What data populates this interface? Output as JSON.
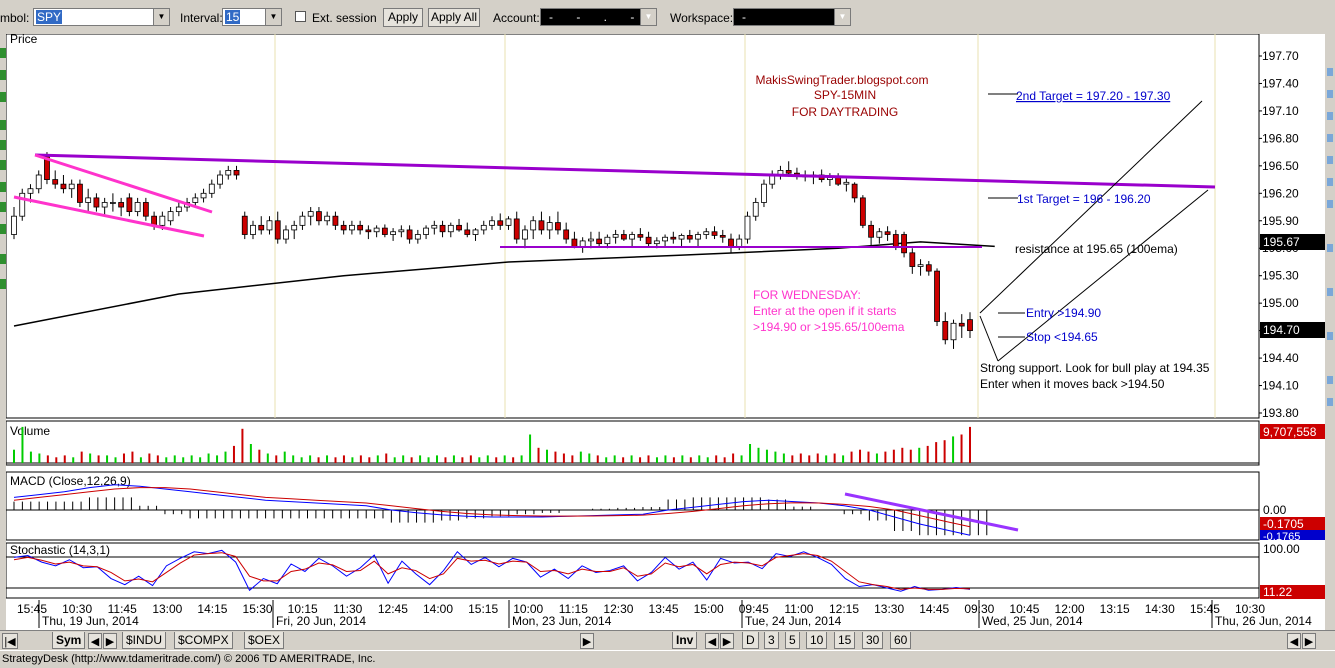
{
  "toolbar": {
    "symbol_label": "mbol:",
    "symbol_value": "SPY",
    "interval_label": "Interval:",
    "interval_value": "15",
    "ext_session_label": "Ext. session",
    "apply_label": "Apply",
    "apply_all_label": "Apply All",
    "account_label": "Account:",
    "account_value": "- - . -",
    "workspace_label": "Workspace:",
    "workspace_value": "-"
  },
  "chart_data": {
    "type": "candlestick",
    "symbol": "SPY",
    "interval": "15",
    "price_panel": {
      "label": "Price",
      "ylim": [
        193.8,
        197.7
      ],
      "yticks": [
        "197.70",
        "197.40",
        "197.10",
        "196.80",
        "196.50",
        "196.20",
        "195.90",
        "195.60",
        "195.30",
        "195.00",
        "194.70",
        "194.40",
        "194.10",
        "193.80"
      ],
      "price_tags": [
        {
          "value": "195.67",
          "price": 195.67,
          "bg": "#000000",
          "fg": "#ffffff"
        },
        {
          "value": "194.70",
          "price": 194.7,
          "bg": "#000000",
          "fg": "#ffffff"
        }
      ],
      "candles": [
        [
          195.75,
          196.05,
          195.7,
          195.95
        ],
        [
          195.95,
          196.25,
          195.9,
          196.2
        ],
        [
          196.2,
          196.3,
          196.1,
          196.25
        ],
        [
          196.25,
          196.45,
          196.2,
          196.4
        ],
        [
          196.6,
          196.65,
          196.3,
          196.35
        ],
        [
          196.35,
          196.45,
          196.25,
          196.3
        ],
        [
          196.3,
          196.4,
          196.2,
          196.25
        ],
        [
          196.25,
          196.35,
          196.15,
          196.3
        ],
        [
          196.3,
          196.35,
          196.05,
          196.1
        ],
        [
          196.1,
          196.25,
          196.0,
          196.15
        ],
        [
          196.15,
          196.2,
          196.0,
          196.05
        ],
        [
          196.05,
          196.15,
          195.95,
          196.1
        ],
        [
          196.1,
          196.2,
          196.0,
          196.1
        ],
        [
          196.1,
          196.15,
          195.95,
          196.05
        ],
        [
          196.15,
          196.2,
          195.95,
          196.0
        ],
        [
          196.0,
          196.15,
          195.95,
          196.1
        ],
        [
          196.1,
          196.15,
          195.9,
          195.95
        ],
        [
          195.95,
          196.0,
          195.8,
          195.85
        ],
        [
          195.85,
          196.0,
          195.8,
          195.95
        ],
        [
          195.9,
          196.05,
          195.85,
          196.0
        ],
        [
          196.0,
          196.1,
          195.95,
          196.05
        ],
        [
          196.05,
          196.15,
          196.0,
          196.1
        ],
        [
          196.1,
          196.2,
          196.05,
          196.15
        ],
        [
          196.15,
          196.25,
          196.1,
          196.2
        ],
        [
          196.2,
          196.35,
          196.15,
          196.3
        ],
        [
          196.3,
          196.45,
          196.25,
          196.4
        ],
        [
          196.4,
          196.5,
          196.35,
          196.45
        ],
        [
          196.45,
          196.5,
          196.35,
          196.4
        ],
        [
          195.95,
          196.0,
          195.7,
          195.75
        ],
        [
          195.75,
          195.9,
          195.7,
          195.85
        ],
        [
          195.85,
          195.95,
          195.75,
          195.8
        ],
        [
          195.8,
          195.95,
          195.75,
          195.9
        ],
        [
          195.9,
          196.0,
          195.65,
          195.7
        ],
        [
          195.7,
          195.85,
          195.65,
          195.8
        ],
        [
          195.8,
          195.9,
          195.7,
          195.85
        ],
        [
          195.85,
          196.0,
          195.8,
          195.95
        ],
        [
          195.95,
          196.05,
          195.85,
          196.0
        ],
        [
          196.0,
          196.05,
          195.85,
          195.9
        ],
        [
          195.9,
          196.0,
          195.85,
          195.95
        ],
        [
          195.95,
          196.0,
          195.8,
          195.85
        ],
        [
          195.85,
          195.9,
          195.75,
          195.8
        ],
        [
          195.8,
          195.9,
          195.75,
          195.85
        ],
        [
          195.85,
          195.9,
          195.75,
          195.8
        ],
        [
          195.8,
          195.85,
          195.7,
          195.78
        ],
        [
          195.78,
          195.85,
          195.72,
          195.82
        ],
        [
          195.82,
          195.86,
          195.72,
          195.75
        ],
        [
          195.75,
          195.82,
          195.68,
          195.78
        ],
        [
          195.78,
          195.85,
          195.72,
          195.8
        ],
        [
          195.8,
          195.85,
          195.65,
          195.7
        ],
        [
          195.7,
          195.8,
          195.65,
          195.75
        ],
        [
          195.75,
          195.85,
          195.7,
          195.82
        ],
        [
          195.82,
          195.9,
          195.75,
          195.85
        ],
        [
          195.85,
          195.9,
          195.72,
          195.78
        ],
        [
          195.78,
          195.88,
          195.72,
          195.85
        ],
        [
          195.85,
          195.92,
          195.78,
          195.8
        ],
        [
          195.8,
          195.88,
          195.72,
          195.75
        ],
        [
          195.75,
          195.82,
          195.68,
          195.8
        ],
        [
          195.8,
          195.9,
          195.75,
          195.85
        ],
        [
          195.85,
          195.95,
          195.8,
          195.9
        ],
        [
          195.9,
          195.98,
          195.8,
          195.85
        ],
        [
          195.85,
          195.95,
          195.8,
          195.92
        ],
        [
          195.92,
          196.0,
          195.65,
          195.7
        ],
        [
          195.7,
          195.85,
          195.6,
          195.8
        ],
        [
          195.8,
          195.95,
          195.7,
          195.9
        ],
        [
          195.9,
          196.0,
          195.75,
          195.8
        ],
        [
          195.8,
          195.95,
          195.7,
          195.88
        ],
        [
          195.88,
          196.0,
          195.75,
          195.8
        ],
        [
          195.8,
          195.88,
          195.65,
          195.7
        ],
        [
          195.7,
          195.78,
          195.6,
          195.62
        ],
        [
          195.62,
          195.72,
          195.55,
          195.68
        ],
        [
          195.68,
          195.78,
          195.6,
          195.7
        ],
        [
          195.7,
          195.78,
          195.62,
          195.65
        ],
        [
          195.65,
          195.75,
          195.6,
          195.72
        ],
        [
          195.72,
          195.8,
          195.65,
          195.75
        ],
        [
          195.75,
          195.8,
          195.68,
          195.7
        ],
        [
          195.7,
          195.78,
          195.62,
          195.75
        ],
        [
          195.75,
          195.82,
          195.68,
          195.72
        ],
        [
          195.72,
          195.78,
          195.62,
          195.65
        ],
        [
          195.65,
          195.72,
          195.6,
          195.68
        ],
        [
          195.68,
          195.75,
          195.62,
          195.72
        ],
        [
          195.72,
          195.78,
          195.65,
          195.7
        ],
        [
          195.7,
          195.76,
          195.62,
          195.74
        ],
        [
          195.74,
          195.8,
          195.66,
          195.7
        ],
        [
          195.7,
          195.78,
          195.62,
          195.75
        ],
        [
          195.75,
          195.82,
          195.7,
          195.78
        ],
        [
          195.78,
          195.84,
          195.7,
          195.74
        ],
        [
          195.74,
          195.8,
          195.66,
          195.72
        ],
        [
          195.7,
          195.76,
          195.55,
          195.62
        ],
        [
          195.62,
          195.75,
          195.58,
          195.7
        ],
        [
          195.7,
          196.0,
          195.65,
          195.95
        ],
        [
          195.95,
          196.15,
          195.9,
          196.1
        ],
        [
          196.1,
          196.35,
          196.05,
          196.3
        ],
        [
          196.3,
          196.45,
          196.25,
          196.4
        ],
        [
          196.4,
          196.5,
          196.35,
          196.45
        ],
        [
          196.45,
          196.55,
          196.38,
          196.42
        ],
        [
          196.42,
          196.48,
          196.35,
          196.4
        ],
        [
          196.4,
          196.45,
          196.33,
          196.38
        ],
        [
          196.38,
          196.44,
          196.3,
          196.4
        ],
        [
          196.4,
          196.46,
          196.32,
          196.35
        ],
        [
          196.35,
          196.42,
          196.28,
          196.38
        ],
        [
          196.38,
          196.42,
          196.28,
          196.3
        ],
        [
          196.3,
          196.36,
          196.22,
          196.32
        ],
        [
          196.3,
          196.32,
          196.1,
          196.15
        ],
        [
          196.15,
          196.18,
          195.82,
          195.85
        ],
        [
          195.85,
          195.9,
          195.62,
          195.72
        ],
        [
          195.72,
          195.82,
          195.65,
          195.78
        ],
        [
          195.78,
          195.84,
          195.68,
          195.75
        ],
        [
          195.75,
          195.8,
          195.58,
          195.62
        ],
        [
          195.75,
          195.78,
          195.5,
          195.55
        ],
        [
          195.55,
          195.6,
          195.32,
          195.4
        ],
        [
          195.4,
          195.48,
          195.3,
          195.42
        ],
        [
          195.42,
          195.46,
          195.3,
          195.35
        ],
        [
          195.35,
          195.38,
          194.75,
          194.8
        ],
        [
          194.8,
          194.9,
          194.55,
          194.6
        ],
        [
          194.6,
          194.82,
          194.5,
          194.78
        ],
        [
          194.78,
          194.88,
          194.62,
          194.75
        ],
        [
          194.82,
          194.9,
          194.62,
          194.7
        ]
      ],
      "ema100": [
        [
          0,
          194.75
        ],
        [
          20,
          195.1
        ],
        [
          40,
          195.3
        ],
        [
          60,
          195.45
        ],
        [
          80,
          195.52
        ],
        [
          100,
          195.6
        ],
        [
          110,
          195.67
        ],
        [
          119,
          195.62
        ]
      ],
      "annotations": {
        "header_line1": "MakisSwingTrader.blogspot.com",
        "header_line2": "SPY-15MIN",
        "header_line3": "FOR DAYTRADING",
        "target2": "2nd Target = 197.20 - 197.30",
        "target1": "1st Target = 196 - 196.20",
        "resistance": "resistance at 195.65 (100ema)",
        "entry": "Entry >194.90",
        "stop": "Stop <194.65",
        "support_line1": "Strong support. Look for bull play at 194.35",
        "support_line2": "Enter when it moves back >194.50",
        "wednesday_line1": "FOR WEDNESDAY:",
        "wednesday_line2": "Enter at the open if it starts",
        "wednesday_line3": ">194.90 or >195.65/100ema"
      }
    },
    "volume_panel": {
      "label": "Volume",
      "value_tag": "9,707,558",
      "values": [
        0.35,
        0.95,
        0.3,
        0.25,
        0.2,
        0.15,
        0.2,
        0.15,
        0.3,
        0.25,
        0.2,
        0.2,
        0.15,
        0.25,
        0.3,
        0.15,
        0.25,
        0.2,
        0.15,
        0.2,
        0.15,
        0.2,
        0.15,
        0.25,
        0.2,
        0.3,
        0.45,
        0.9,
        0.5,
        0.35,
        0.25,
        0.2,
        0.3,
        0.2,
        0.15,
        0.2,
        0.15,
        0.2,
        0.15,
        0.2,
        0.15,
        0.2,
        0.15,
        0.2,
        0.25,
        0.15,
        0.2,
        0.15,
        0.2,
        0.15,
        0.2,
        0.15,
        0.2,
        0.15,
        0.2,
        0.15,
        0.2,
        0.15,
        0.2,
        0.15,
        0.2,
        0.75,
        0.4,
        0.35,
        0.3,
        0.25,
        0.2,
        0.3,
        0.25,
        0.2,
        0.15,
        0.2,
        0.15,
        0.2,
        0.15,
        0.2,
        0.15,
        0.2,
        0.15,
        0.2,
        0.15,
        0.2,
        0.15,
        0.2,
        0.15,
        0.25,
        0.2,
        0.5,
        0.4,
        0.35,
        0.3,
        0.25,
        0.2,
        0.25,
        0.2,
        0.25,
        0.2,
        0.25,
        0.2,
        0.3,
        0.35,
        0.3,
        0.25,
        0.3,
        0.35,
        0.4,
        0.35,
        0.4,
        0.45,
        0.55,
        0.6,
        0.7,
        0.75,
        0.95
      ]
    },
    "macd_panel": {
      "label": "MACD (Close,12,26,9)",
      "ytick": "0.00",
      "value_tags": [
        {
          "value": "-0.1705",
          "bg": "#cc0000",
          "fg": "#ffffff"
        },
        {
          "value": "-0.1765",
          "bg": "#0000cc",
          "fg": "#ffffff"
        }
      ],
      "macd": [
        0.09,
        0.11,
        0.13,
        0.16,
        0.18,
        0.17,
        0.15,
        0.13,
        0.11,
        0.09,
        0.07,
        0.06,
        0.05,
        0.04,
        0.03,
        0.0,
        -0.02,
        -0.035,
        -0.045,
        -0.05,
        -0.05,
        -0.05,
        -0.045,
        -0.04,
        -0.035,
        -0.03,
        0.0,
        0.02,
        0.04,
        0.06,
        0.07,
        0.06,
        0.05,
        0.03,
        0.0,
        -0.05,
        -0.1,
        -0.14,
        -0.18
      ],
      "signal": [
        0.07,
        0.09,
        0.11,
        0.13,
        0.15,
        0.16,
        0.16,
        0.15,
        0.13,
        0.11,
        0.09,
        0.08,
        0.07,
        0.06,
        0.05,
        0.03,
        0.01,
        -0.01,
        -0.025,
        -0.035,
        -0.04,
        -0.043,
        -0.044,
        -0.043,
        -0.04,
        -0.037,
        -0.025,
        -0.01,
        0.01,
        0.03,
        0.045,
        0.052,
        0.05,
        0.04,
        0.025,
        0.0,
        -0.04,
        -0.08,
        -0.12
      ]
    },
    "stochastic_panel": {
      "label": "Stochastic (14,3,1)",
      "ytick": "100.00",
      "value_tag": "11.22",
      "k": [
        80,
        84,
        70,
        62,
        75,
        58,
        60,
        35,
        22,
        40,
        20,
        62,
        78,
        92,
        88,
        95,
        70,
        10,
        35,
        24,
        66,
        50,
        78,
        62,
        40,
        58,
        85,
        25,
        72,
        45,
        22,
        52,
        92,
        65,
        80,
        60,
        78,
        70,
        38,
        55,
        35,
        62,
        48,
        52,
        62,
        30,
        48,
        80,
        55,
        70,
        32,
        78,
        68,
        70,
        56,
        88,
        82,
        92,
        80,
        65,
        35,
        18,
        22,
        15,
        8,
        18,
        10,
        12,
        16,
        12
      ],
      "d": [
        75,
        80,
        74,
        66,
        70,
        62,
        60,
        48,
        30,
        34,
        28,
        48,
        68,
        85,
        88,
        90,
        82,
        40,
        30,
        30,
        50,
        55,
        68,
        64,
        50,
        52,
        72,
        45,
        58,
        52,
        35,
        45,
        78,
        72,
        74,
        66,
        72,
        70,
        50,
        52,
        45,
        55,
        50,
        50,
        58,
        40,
        45,
        68,
        60,
        65,
        45,
        65,
        70,
        68,
        62,
        80,
        84,
        88,
        84,
        72,
        50,
        28,
        22,
        18,
        12,
        15,
        12,
        12,
        14,
        13
      ]
    },
    "x_axis": {
      "time_labels": [
        "15:45",
        "10:30",
        "11:45",
        "13:00",
        "14:15",
        "15:30",
        "10:15",
        "11:30",
        "12:45",
        "14:00",
        "15:15",
        "10:00",
        "11:15",
        "12:30",
        "13:45",
        "15:00",
        "09:45",
        "11:00",
        "12:15",
        "13:30",
        "14:45",
        "09:30",
        "10:45",
        "12:00",
        "13:15",
        "14:30",
        "15:45",
        "10:30"
      ],
      "date_labels": [
        "Thu, 19 Jun, 2014",
        "Fri, 20 Jun, 2014",
        "Mon, 23 Jun, 2014",
        "Tue, 24 Jun, 2014",
        "Wed, 25 Jun, 2014",
        "Thu, 26 Jun, 2014"
      ]
    }
  },
  "bottom": {
    "sym_label": "Sym",
    "inv_label": "Inv",
    "tabs": [
      "$INDU",
      "$COMPX",
      "$OEX"
    ],
    "intervals": [
      "D",
      "3",
      "5",
      "10",
      "15",
      "30",
      "60"
    ]
  },
  "status_text": "StrategyDesk (http://www.tdameritrade.com/) © 2006 TD AMERITRADE, Inc."
}
